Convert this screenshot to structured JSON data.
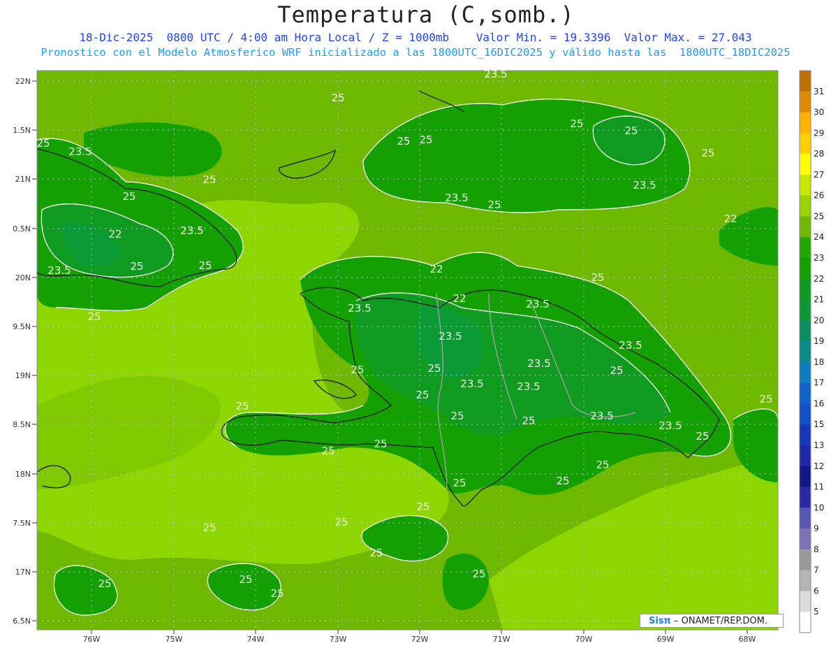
{
  "header": {
    "title": "Temperatura (C,somb.)",
    "subtitle1": "18-Dic-2025  0800 UTC / 4:00 am Hora Local / Z = 1000mb    Valor Min. = 19.3396  Valor Max. = 27.043",
    "subtitle2": "Pronostico con el Modelo Atmosferico WRF inicializado a las 1800UTC_16DIC2025 y válido hasta las  1800UTC_18DIC2025"
  },
  "axes": {
    "lat_labels": [
      "22N",
      "1.5N",
      "21N",
      "0.5N",
      "20N",
      "9.5N",
      "19N",
      "8.5N",
      "18N",
      "7.5N",
      "17N",
      "6.5N"
    ],
    "lon_labels": [
      "76W",
      "75W",
      "74W",
      "73W",
      "72W",
      "71W",
      "70W",
      "69W",
      "68W"
    ]
  },
  "colorbar": {
    "labels": [
      "31",
      "30",
      "29",
      "28",
      "27",
      "26",
      "25",
      "24",
      "23",
      "22",
      "21",
      "20",
      "19",
      "18",
      "17",
      "16",
      "15",
      "13",
      "12",
      "11",
      "10",
      "9",
      "8",
      "7",
      "6",
      "5"
    ],
    "colors": [
      "#c07000",
      "#e08a00",
      "#ffb300",
      "#ffd000",
      "#ffff00",
      "#c8e800",
      "#99d300",
      "#6fb800",
      "#1fa800",
      "#14a000",
      "#0f9a20",
      "#0a9a35",
      "#089060",
      "#0a8c88",
      "#0a7ec0",
      "#1063cc",
      "#1450cc",
      "#1438b8",
      "#1e28a8",
      "#101888",
      "#2a2aa8",
      "#5858b4",
      "#8070b4",
      "#9a9a9a",
      "#b4b4b4",
      "#dcdcdc",
      "#ffffff"
    ]
  },
  "contour_labels": [
    "25",
    "23.5",
    "22",
    "25",
    "23.5",
    "25",
    "25",
    "23.5",
    "25",
    "25",
    "25",
    "23.5",
    "25",
    "25",
    "23.5",
    "25",
    "25",
    "25",
    "25",
    "23.5",
    "22",
    "22",
    "23.5",
    "22",
    "23.5",
    "25",
    "25",
    "23.5",
    "23.5",
    "23.5",
    "25",
    "23.5",
    "25",
    "23.5",
    "23.5",
    "23.5",
    "25",
    "25",
    "25",
    "25",
    "25",
    "25",
    "25",
    "25",
    "25",
    "25",
    "25",
    "25",
    "25",
    "25",
    "25",
    "25",
    "25",
    "25",
    "25"
  ],
  "credit": {
    "brand": "Sisπ",
    "org": "– ONAMET/REP.DOM."
  }
}
